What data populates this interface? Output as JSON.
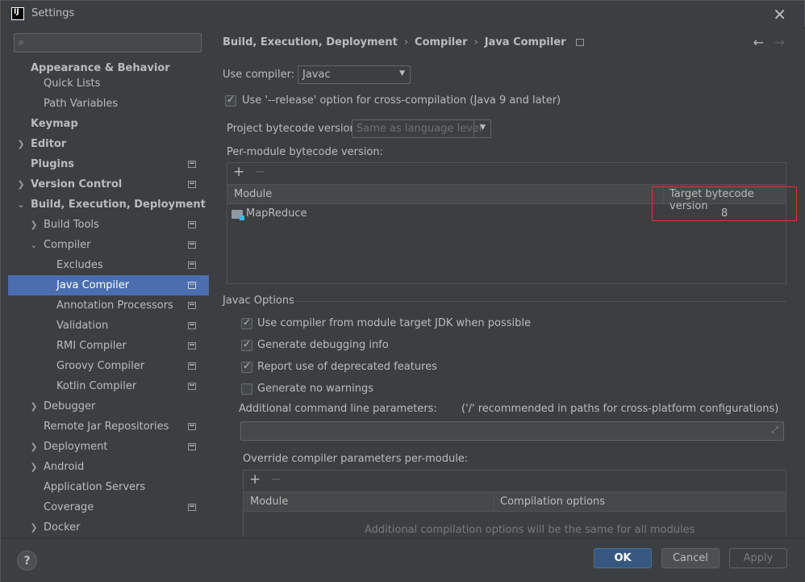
{
  "window": {
    "title": "Settings",
    "logo": "IJ"
  },
  "sidebar": {
    "search_placeholder": "",
    "items": [
      {
        "label": "Appearance & Behavior"
      },
      {
        "label": "Quick Lists"
      },
      {
        "label": "Path Variables"
      },
      {
        "label": "Keymap"
      },
      {
        "label": "Editor"
      },
      {
        "label": "Plugins"
      },
      {
        "label": "Version Control"
      },
      {
        "label": "Build, Execution, Deployment"
      },
      {
        "label": "Build Tools"
      },
      {
        "label": "Compiler"
      },
      {
        "label": "Excludes"
      },
      {
        "label": "Java Compiler"
      },
      {
        "label": "Annotation Processors"
      },
      {
        "label": "Validation"
      },
      {
        "label": "RMI Compiler"
      },
      {
        "label": "Groovy Compiler"
      },
      {
        "label": "Kotlin Compiler"
      },
      {
        "label": "Debugger"
      },
      {
        "label": "Remote Jar Repositories"
      },
      {
        "label": "Deployment"
      },
      {
        "label": "Android"
      },
      {
        "label": "Application Servers"
      },
      {
        "label": "Coverage"
      },
      {
        "label": "Docker"
      }
    ]
  },
  "breadcrumb": [
    "Build, Execution, Deployment",
    "Compiler",
    "Java Compiler"
  ],
  "compiler": {
    "use_compiler_label": "Use compiler:",
    "use_compiler_value": "Javac",
    "release_option_label": "Use '--release' option for cross-compilation (Java 9 and later)",
    "project_bytecode_label": "Project bytecode version:",
    "project_bytecode_value": "Same as language level",
    "per_module_label": "Per-module bytecode version:",
    "module_table": {
      "columns": [
        "Module",
        "Target bytecode version"
      ],
      "rows": [
        {
          "module": "MapReduce",
          "target": "8"
        }
      ]
    }
  },
  "javac": {
    "section_title": "Javac Options",
    "options": [
      {
        "label": "Use compiler from module target JDK when possible",
        "checked": true
      },
      {
        "label": "Generate debugging info",
        "checked": true
      },
      {
        "label": "Report use of deprecated features",
        "checked": true
      },
      {
        "label": "Generate no warnings",
        "checked": false
      }
    ],
    "additional_params_label": "Additional command line parameters:",
    "additional_params_hint": "('/' recommended in paths for cross-platform configurations)",
    "additional_params_value": "",
    "override_label": "Override compiler parameters per-module:",
    "override_table": {
      "columns": [
        "Module",
        "Compilation options"
      ],
      "empty_text": "Additional compilation options will be the same for all modules"
    }
  },
  "buttons": {
    "help": "?",
    "ok": "OK",
    "cancel": "Cancel",
    "apply": "Apply"
  },
  "colors": {
    "selection": "#4b6eaf",
    "primary_button": "#365880",
    "highlight_box": "#e0332b"
  }
}
